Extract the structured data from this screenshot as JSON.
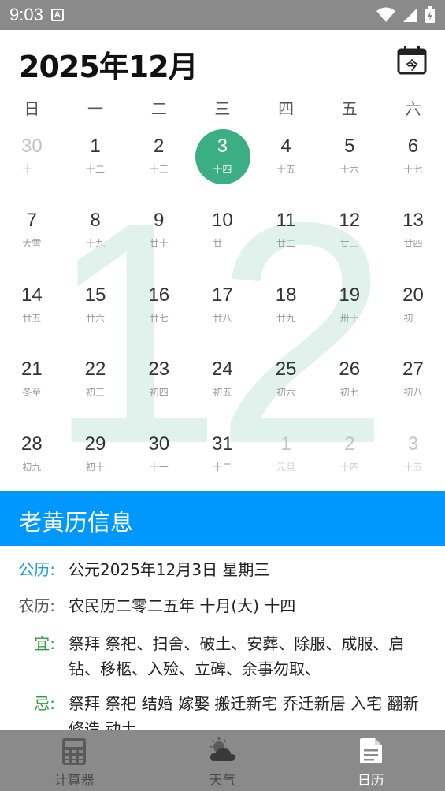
{
  "status_bar": {
    "time": "9:03",
    "notif": "A"
  },
  "header": {
    "title": "2025年12月",
    "today_label": "今"
  },
  "calendar": {
    "watermark": "12",
    "weekdays": [
      "日",
      "一",
      "二",
      "三",
      "四",
      "五",
      "六"
    ],
    "weeks": [
      [
        {
          "num": "30",
          "lunar": "十一",
          "other": true
        },
        {
          "num": "1",
          "lunar": "十二"
        },
        {
          "num": "2",
          "lunar": "十三"
        },
        {
          "num": "3",
          "lunar": "十四",
          "selected": true
        },
        {
          "num": "4",
          "lunar": "十五"
        },
        {
          "num": "5",
          "lunar": "十六"
        },
        {
          "num": "6",
          "lunar": "十七"
        }
      ],
      [
        {
          "num": "7",
          "lunar": "大雪"
        },
        {
          "num": "8",
          "lunar": "十九"
        },
        {
          "num": "9",
          "lunar": "廿十"
        },
        {
          "num": "10",
          "lunar": "廿一"
        },
        {
          "num": "11",
          "lunar": "廿二"
        },
        {
          "num": "12",
          "lunar": "廿三"
        },
        {
          "num": "13",
          "lunar": "廿四"
        }
      ],
      [
        {
          "num": "14",
          "lunar": "廿五"
        },
        {
          "num": "15",
          "lunar": "廿六"
        },
        {
          "num": "16",
          "lunar": "廿七"
        },
        {
          "num": "17",
          "lunar": "廿八"
        },
        {
          "num": "18",
          "lunar": "廿九"
        },
        {
          "num": "19",
          "lunar": "卅十"
        },
        {
          "num": "20",
          "lunar": "初一"
        }
      ],
      [
        {
          "num": "21",
          "lunar": "冬至"
        },
        {
          "num": "22",
          "lunar": "初三"
        },
        {
          "num": "23",
          "lunar": "初四"
        },
        {
          "num": "24",
          "lunar": "初五"
        },
        {
          "num": "25",
          "lunar": "初六"
        },
        {
          "num": "26",
          "lunar": "初七"
        },
        {
          "num": "27",
          "lunar": "初八"
        }
      ],
      [
        {
          "num": "28",
          "lunar": "初九"
        },
        {
          "num": "29",
          "lunar": "初十"
        },
        {
          "num": "30",
          "lunar": "十一"
        },
        {
          "num": "31",
          "lunar": "十二"
        },
        {
          "num": "1",
          "lunar": "元旦",
          "other": true
        },
        {
          "num": "2",
          "lunar": "十四",
          "other": true
        },
        {
          "num": "3",
          "lunar": "十五",
          "other": true
        }
      ]
    ]
  },
  "almanac": {
    "title": "老黄历信息",
    "gregorian": {
      "label": "公历:",
      "value": "公元2025年12月3日 星期三"
    },
    "lunar": {
      "label": "农历:",
      "value": "农民历二零二五年 十月(大) 十四"
    },
    "yi": {
      "label": "宜:",
      "value": "祭拜 祭祀、扫舍、破土、安葬、除服、成服、启钻、移柩、入殓、立碑、余事勿取、"
    },
    "ji": {
      "label": "忌:",
      "value": "祭拜 祭祀 结婚 嫁娶 搬迁新宅 乔迁新居 入宅 翻新 修造 动土"
    }
  },
  "bottom_nav": {
    "items": [
      {
        "label": "计算器",
        "icon": "calculator-icon"
      },
      {
        "label": "天气",
        "icon": "weather-icon"
      },
      {
        "label": "日历",
        "icon": "calendar-doc-icon",
        "active": true
      }
    ]
  },
  "colors": {
    "accent_green": "#3cae83",
    "almanac_blue": "#0098ff",
    "bar_gray": "#8a8a8a"
  }
}
